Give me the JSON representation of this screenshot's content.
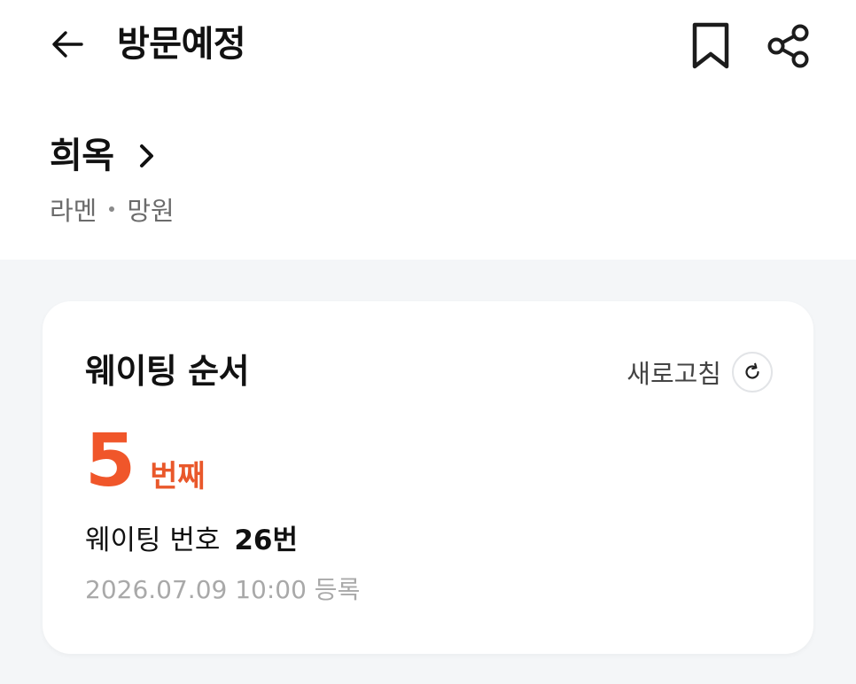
{
  "header": {
    "title": "방문예정",
    "back_icon": "arrow-left-icon",
    "bookmark_icon": "bookmark-icon",
    "share_icon": "share-icon"
  },
  "store": {
    "name": "희옥",
    "category": "라멘",
    "location": "망원"
  },
  "waiting_card": {
    "title": "웨이팅 순서",
    "refresh_label": "새로고침",
    "order_number": "5",
    "order_unit": "번째",
    "wait_number_label": "웨이팅 번호",
    "wait_number_value": "26번",
    "registered_text": "2026.07.09 10:00 등록"
  },
  "colors": {
    "accent": "#f0562a",
    "background_gray": "#f4f6f8",
    "text_primary": "#111111",
    "text_secondary": "#6b6b6b",
    "text_muted": "#a9a9a9"
  }
}
